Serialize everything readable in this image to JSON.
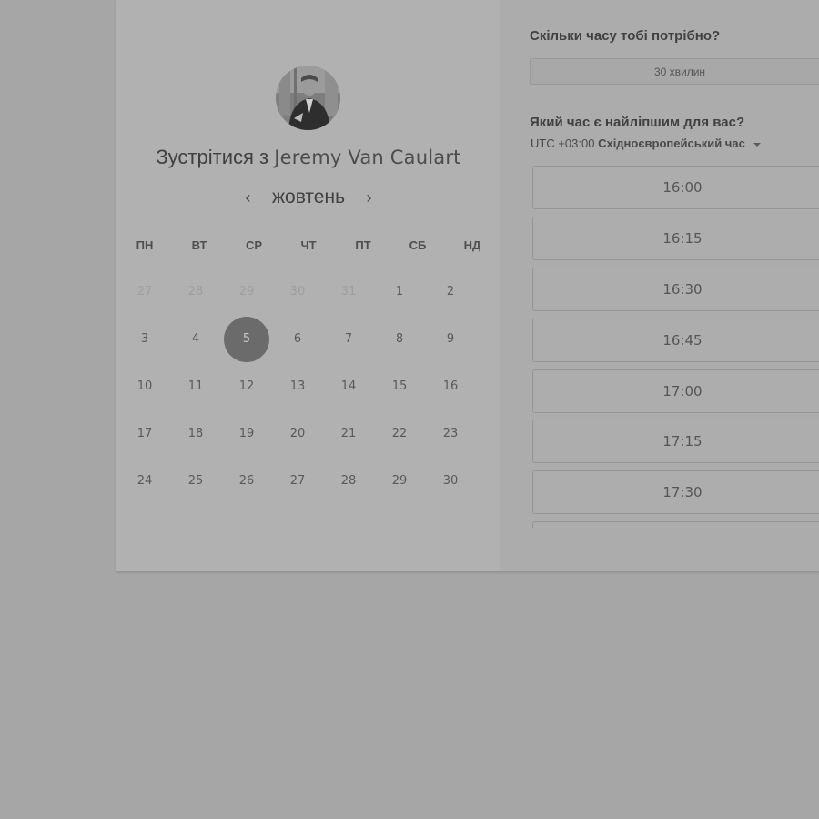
{
  "scheduler": {
    "title_prefix": "Зустрітися з",
    "host_name": "Jeremy Van Caulart",
    "calendar": {
      "month": "жовтень",
      "weekdays": [
        "ПН",
        "ВТ",
        "СР",
        "ЧТ",
        "ПТ",
        "СБ",
        "НД"
      ],
      "weeks": [
        [
          "27",
          "28",
          "29",
          "30",
          "31",
          "1",
          "2"
        ],
        [
          "3",
          "4",
          "5",
          "6",
          "7",
          "8",
          "9"
        ],
        [
          "10",
          "11",
          "12",
          "13",
          "14",
          "15",
          "16"
        ],
        [
          "17",
          "18",
          "19",
          "20",
          "21",
          "22",
          "23"
        ],
        [
          "24",
          "25",
          "26",
          "27",
          "28",
          "29",
          "30"
        ]
      ],
      "selected_day": "5"
    },
    "duration_question": "Скільки часу тобі потрібно?",
    "duration_option": "30 хвилин",
    "time_question": "Який час є найліпшим для вас?",
    "timezone_offset": "UTC +03:00",
    "timezone_name": "Східноєвропейський час",
    "time_slots": [
      "16:00",
      "16:15",
      "16:30",
      "16:45",
      "17:00",
      "17:15",
      "17:30"
    ]
  }
}
